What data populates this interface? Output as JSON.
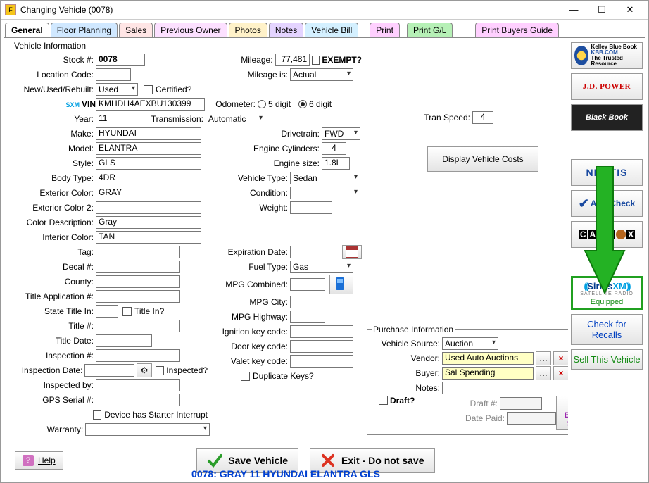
{
  "window": {
    "title": "Changing Vehicle  (0078)"
  },
  "tabs": {
    "general": "General",
    "floor": "Floor Planning",
    "sales": "Sales",
    "prev": "Previous Owner",
    "photos": "Photos",
    "notes": "Notes",
    "bill": "Vehicle Bill",
    "print": "Print",
    "pgl": "Print G/L",
    "guide": "Print Buyers Guide"
  },
  "groups": {
    "vehicle": "Vehicle Information",
    "purchase": "Purchase Information"
  },
  "labels": {
    "stock": "Stock #:",
    "mileage": "Mileage:",
    "exempt": "EXEMPT?",
    "loccode": "Location Code:",
    "mileageis": "Mileage is:",
    "nur": "New/Used/Rebuilt:",
    "certified": "Certified?",
    "vin": "VIN:",
    "odometer": "Odometer:",
    "od5": "5 digit",
    "od6": "6 digit",
    "year": "Year:",
    "trans": "Transmission:",
    "transpeed": "Tran Speed:",
    "make": "Make:",
    "drivetrain": "Drivetrain:",
    "model": "Model:",
    "cyl": "Engine Cylinders:",
    "style": "Style:",
    "engsize": "Engine size:",
    "bodytype": "Body Type:",
    "vtype": "Vehicle Type:",
    "extcolor": "Exterior Color:",
    "cond": "Condition:",
    "extcolor2": "Exterior Color 2:",
    "weight": "Weight:",
    "colordesc": "Color Description:",
    "intcolor": "Interior Color:",
    "tag": "Tag:",
    "expdate": "Expiration Date:",
    "decal": "Decal #:",
    "fueltype": "Fuel Type:",
    "county": "County:",
    "mpgc": "MPG Combined:",
    "titleapp": "Title Application #:",
    "mpgcity": "MPG City:",
    "statetitle": "State Title In:",
    "titlein": "Title In?",
    "mpghwy": "MPG Highway:",
    "titlenum": "Title #:",
    "ignkey": "Ignition key code:",
    "titledate": "Title Date:",
    "doorkey": "Door key code:",
    "insp": "Inspection #:",
    "valet": "Valet key code:",
    "inspdate": "Inspection Date:",
    "inspected": "Inspected?",
    "dupkeys": "Duplicate Keys?",
    "inspby": "Inspected by:",
    "gps": "GPS Serial #:",
    "starter": "Device has Starter Interrupt",
    "warranty": "Warranty:",
    "vsrc": "Vehicle Source:",
    "vendor": "Vendor:",
    "buyer": "Buyer:",
    "notesp": "Notes:",
    "draft": "Draft?",
    "draftn": "Draft #:",
    "datepaid": "Date Paid:",
    "billofsale": "Bill of Sale"
  },
  "values": {
    "stock": "0078",
    "mileage": "77,481",
    "mileageis": "Actual",
    "nur": "Used",
    "vin": "KMHDH4AEXBU130399",
    "year": "11",
    "trans": "Automatic",
    "transpeed": "4",
    "make": "HYUNDAI",
    "drivetrain": "FWD",
    "model": "ELANTRA",
    "cyl": "4",
    "style": "GLS",
    "engsize": "1.8L",
    "bodytype": "4DR",
    "vtype": "Sedan",
    "extcolor": "GRAY",
    "cond": "",
    "extcolor2": "",
    "weight": "",
    "colordesc": "Gray",
    "intcolor": "TAN",
    "fueltype": "Gas",
    "vsrc": "Auction",
    "vendor": "Used Auto Auctions",
    "buyer": "Sal Spending",
    "loccode": "",
    "tag": "",
    "expdate": "",
    "decal": "",
    "county": "",
    "mpgc": "",
    "titleapp": "",
    "mpgcity": "",
    "statetitle": "",
    "mpghwy": "",
    "titlenum": "",
    "ignkey": "",
    "titledate": "",
    "doorkey": "",
    "insp": "",
    "valet": "",
    "inspdate": "",
    "inspby": "",
    "gps": "",
    "warranty": "",
    "notesp": "",
    "draftn": "",
    "datepaid": ""
  },
  "buttons": {
    "dispcost": "Display Vehicle Costs",
    "save": "Save Vehicle",
    "exit": "Exit - Do not save",
    "help": "Help",
    "recalls": "Check for Recalls",
    "sell": "Sell This Vehicle"
  },
  "sidebar": {
    "kbb": "KBB.COM",
    "kbb2": "Kelley Blue Book",
    "kbb3": "The Trusted Resource",
    "jd": "J.D. POWER",
    "bb": "Black Book",
    "nmvtis": "NMVTIS",
    "autocheck": "AutoCheck",
    "carfax": "CARFAX",
    "sirius": "SiriusXM",
    "sirius_sub": "SATELLITE RADIO",
    "sirius_eq": "Equipped"
  },
  "footer": "0078: GRAY 11 HYUNDAI ELANTRA GLS",
  "sxm_badge": "SXM"
}
